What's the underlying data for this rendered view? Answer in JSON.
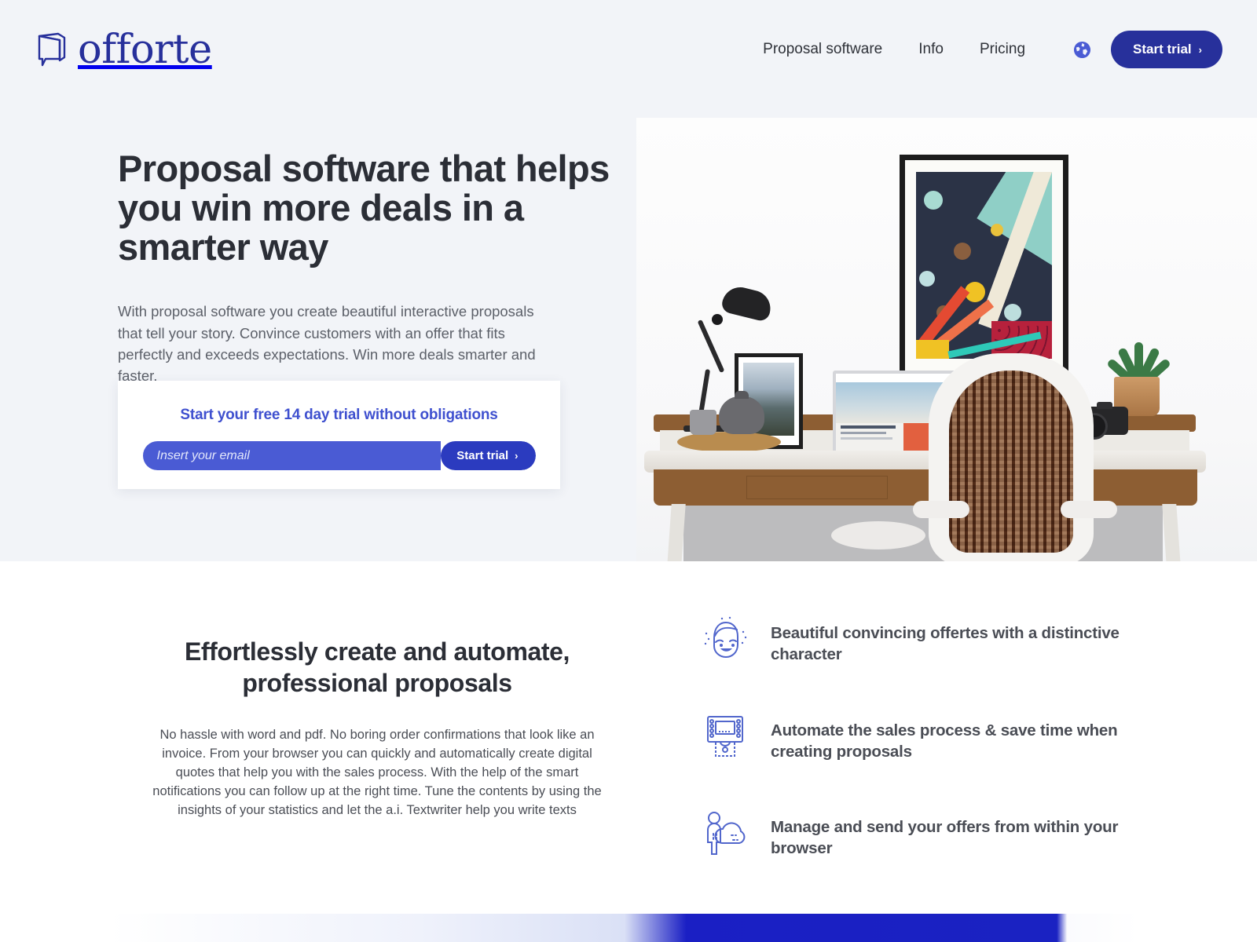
{
  "brand": {
    "name": "offorte",
    "logo_icon": "speech-bubble-book-icon",
    "color": "#27309b"
  },
  "header": {
    "nav": [
      {
        "label": "Proposal software"
      },
      {
        "label": "Info"
      },
      {
        "label": "Pricing"
      }
    ],
    "language_icon": "globe-icon",
    "cta": {
      "label": "Start trial",
      "chevron": "›",
      "bg": "#27309b"
    }
  },
  "hero": {
    "title": "Proposal software that helps you win more deals in a smarter way",
    "subtitle": "With proposal software you create beautiful interactive proposals that tell your story. Convince customers with an offer that fits perfectly and exceeds expectations. Win more deals smarter and faster.",
    "background": "#f2f4f8",
    "image_alt": "desk-workspace-photo"
  },
  "signup": {
    "title": "Start your free 14 day trial without obligations",
    "title_color": "#3f50cf",
    "email_placeholder": "Insert your email",
    "email_value": "",
    "input_bg": "#4a5bd4",
    "submit_label": "Start trial",
    "submit_chevron": "›",
    "submit_bg": "#2b3bbf"
  },
  "section2": {
    "title": "Effortlessly create and automate, professional proposals",
    "body": "No hassle with word and pdf. No boring order confirmations that look like an invoice. From your browser you can quickly and automatically create digital quotes that help you with the sales process. With the help of the smart notifications you can follow up at the right time. Tune the contents by using the insights of your statistics and let the a.i. Textwriter help you write texts",
    "features": [
      {
        "icon": "smiling-face-icon",
        "text": "Beautiful convincing offertes with a distinctive character"
      },
      {
        "icon": "atm-machine-icon",
        "text": "Automate the sales process & save time when creating proposals"
      },
      {
        "icon": "person-cloud-icon",
        "text": "Manage and send your offers from within your browser"
      }
    ],
    "icon_color": "#5166cc"
  },
  "bottom_band": {
    "color": "#1a22c2"
  }
}
